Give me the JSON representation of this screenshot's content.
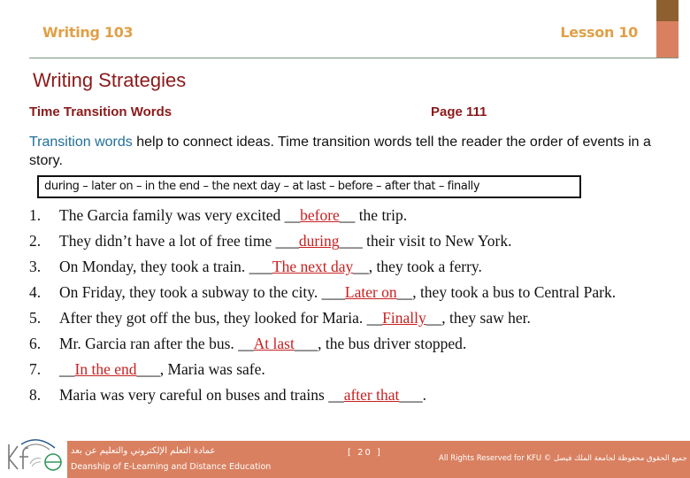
{
  "header": {
    "course": "Writing 103",
    "lesson": "Lesson 10",
    "colors": {
      "header_text": "#e0a048",
      "accent_dark": "#8e6030",
      "accent_light": "#d98060",
      "divider": "#7a9480"
    }
  },
  "title": "Writing Strategies",
  "subtitle": "Time Transition Words",
  "page_ref": "Page 111",
  "intro": {
    "highlight": "Transition words",
    "rest": " help to connect ideas. Time transition words tell the reader the order of events in a story."
  },
  "word_bank": "during – later on – in the end – the next day – at last – before – after that – finally",
  "exercises": [
    {
      "num": "1.",
      "before": "The Garcia family was very excited __",
      "answer": "before",
      "after": "__ the trip."
    },
    {
      "num": "2.",
      "before": "They didn’t have a lot of free time ___",
      "answer": "during",
      "after": "___ their visit to New York."
    },
    {
      "num": "3.",
      "before": "On Monday, they took a train. ___",
      "answer": "The next day",
      "after": "__, they took a ferry."
    },
    {
      "num": "4.",
      "before": "On Friday, they took a subway to the city. ___",
      "answer": "Later on",
      "after": "__, they took a bus to Central Park."
    },
    {
      "num": "5.",
      "before": "After they got off the bus, they looked for Maria. __",
      "answer": "Finally",
      "after": "__, they saw her."
    },
    {
      "num": "6.",
      "before": "Mr. Garcia ran after the bus. __",
      "answer": "At last",
      "after": "___, the bus driver stopped."
    },
    {
      "num": "7.",
      "before": "__",
      "answer": "In the end",
      "after": "___, Maria was safe."
    },
    {
      "num": "8.",
      "before": "Maria was very careful on buses and trains __",
      "answer": "after that",
      "after": "___."
    }
  ],
  "answer_color": "#c82020",
  "footer": {
    "logo": "kfu-elearning-logo",
    "arabic": "عمادة التعلم الإلكتروني والتعليم عن بعد",
    "english": "Deanship of E-Learning and Distance Education",
    "page_number": "[ 20 ]",
    "rights": "All Rights Reserved for KFU © جميع الحقوق محفوظة لجامعة الملك فيصل",
    "band_color": "#d98060"
  }
}
